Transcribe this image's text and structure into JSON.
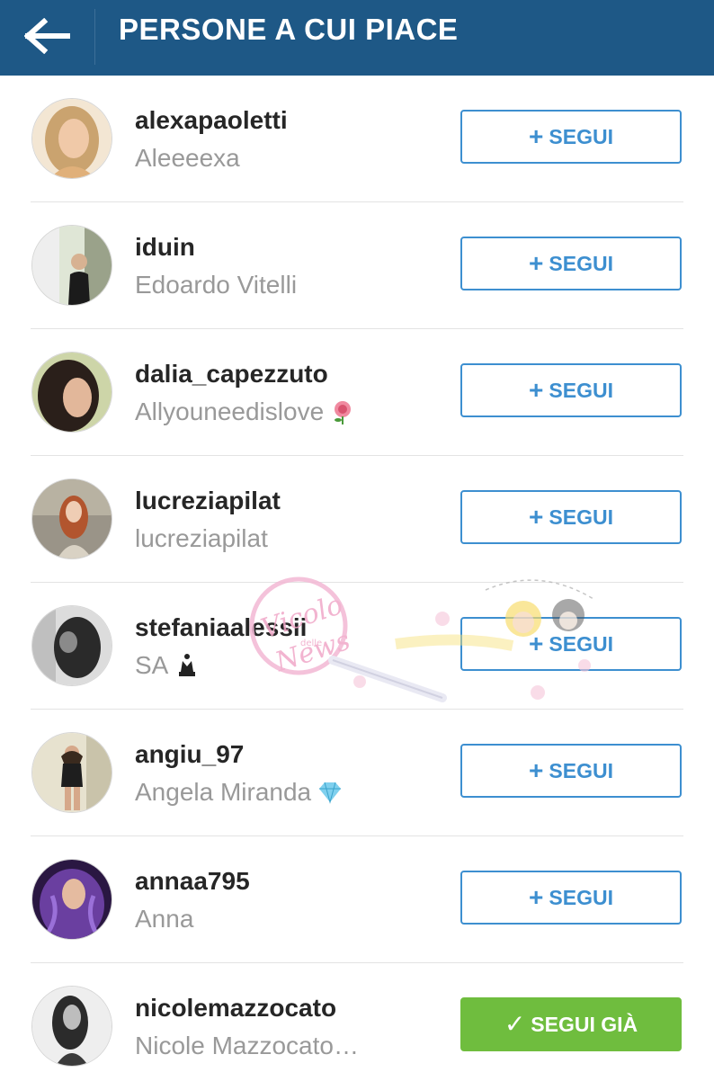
{
  "header": {
    "title": "PERSONE A CUI PIACE",
    "back_icon": "arrow-left-icon"
  },
  "colors": {
    "header_bg": "#1e5886",
    "follow_accent": "#3d8fd0",
    "following_green": "#6fbd3e",
    "username_text": "#262626",
    "fullname_text": "#999999"
  },
  "users": [
    {
      "username": "alexapaoletti",
      "fullname": "Aleeeexa",
      "emoji": "",
      "button_label": "SEGUI",
      "button_icon": "plus-icon",
      "following": false
    },
    {
      "username": "iduin",
      "fullname": "Edoardo Vitelli",
      "emoji": "",
      "button_label": "SEGUI",
      "button_icon": "plus-icon",
      "following": false
    },
    {
      "username": "dalia_capezzuto",
      "fullname": "Allyouneedislove",
      "emoji": "rose-icon",
      "button_label": "SEGUI",
      "button_icon": "plus-icon",
      "following": false
    },
    {
      "username": "lucreziapilat",
      "fullname": "lucreziapilat",
      "emoji": "",
      "button_label": "SEGUI",
      "button_icon": "plus-icon",
      "following": false
    },
    {
      "username": "stefaniaalessii",
      "fullname": "SA",
      "emoji": "chess-queen-icon",
      "button_label": "SEGUI",
      "button_icon": "plus-icon",
      "following": false
    },
    {
      "username": "angiu_97",
      "fullname": "Angela Miranda",
      "emoji": "gem-icon",
      "button_label": "SEGUI",
      "button_icon": "plus-icon",
      "following": false
    },
    {
      "username": "annaa795",
      "fullname": "Anna",
      "emoji": "",
      "button_label": "SEGUI",
      "button_icon": "plus-icon",
      "following": false
    },
    {
      "username": "nicolemazzocato",
      "fullname": "Nicole Mazzocato…",
      "emoji": "",
      "button_label": "SEGUI GIÀ",
      "button_icon": "check-icon",
      "following": true
    }
  ],
  "watermark": {
    "text_main": "Vicolo",
    "text_small": "delle",
    "text_news": "News"
  }
}
